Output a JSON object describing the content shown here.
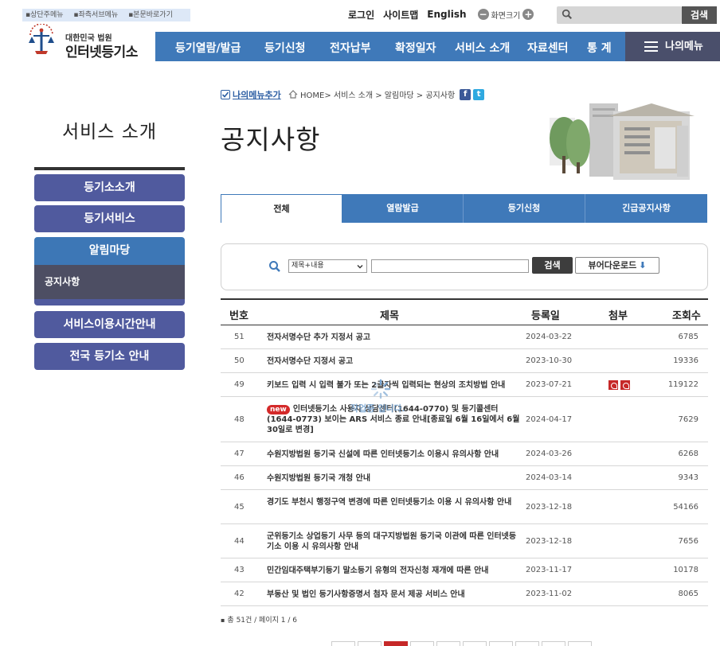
{
  "skip_links": [
    "상단주메뉴",
    "좌측서브메뉴",
    "본문바로가기"
  ],
  "util": {
    "login": "로그인",
    "sitemap": "사이트맵",
    "english": "English",
    "zoom_label": "화면크기",
    "search_button": "검색"
  },
  "logo": {
    "line1": "대한민국 법원",
    "line2": "인터넷등기소"
  },
  "gnb": {
    "items": [
      "등기열람/발급",
      "등기신청",
      "전자납부",
      "확정일자",
      "서비스 소개",
      "자료센터",
      "통 계"
    ],
    "mymenu": "나의메뉴"
  },
  "lnb": {
    "title": "서비스 소개",
    "items": [
      "등기소소개",
      "등기서비스",
      "알림마당",
      "서비스이용시간안내",
      "전국 등기소 안내"
    ],
    "active_sub": "공지사항"
  },
  "content": {
    "add_menu": "나의메뉴추가",
    "breadcrumb": "HOME> 서비스 소개 > 알림마당 > 공지사항",
    "title": "공지사항"
  },
  "tabs": [
    "전체",
    "열람발급",
    "등기신청",
    "긴급공지사항"
  ],
  "search": {
    "select_value": "제목+내용",
    "input_value": "",
    "search_button": "검색",
    "viewer_button": "뷰어다운로드"
  },
  "table": {
    "headers": [
      "번호",
      "제목",
      "등록일",
      "첨부",
      "조회수"
    ],
    "rows": [
      {
        "no": "51",
        "title": "전자서명수단 추가 지정서 공고",
        "date": "2024-03-22",
        "attach": 0,
        "views": "6785",
        "new": false
      },
      {
        "no": "50",
        "title": "전자서명수단 지정서 공고",
        "date": "2023-10-30",
        "attach": 0,
        "views": "19336",
        "new": false
      },
      {
        "no": "49",
        "title": "키보드 입력 시 입력 불가 또는 2글자씩 입력되는 현상의 조치방법 안내",
        "date": "2023-07-21",
        "attach": 2,
        "views": "119122",
        "new": false
      },
      {
        "no": "48",
        "title": "인터넷등기소 사용자 상담센터(1644-0770) 및 등기콜센터(1644-0773) 보이는 ARS 서비스 종료 안내[종료일 6월 16일에서 6월 30일로 변경]",
        "date": "2024-04-17",
        "attach": 0,
        "views": "7629",
        "new": true
      },
      {
        "no": "47",
        "title": "수원지방법원 등기국 신설에 따른 인터넷등기소 이용시 유의사항 안내",
        "date": "2024-03-26",
        "attach": 0,
        "views": "6268",
        "new": false
      },
      {
        "no": "46",
        "title": "수원지방법원 등기국 개청 안내",
        "date": "2024-03-14",
        "attach": 0,
        "views": "9343",
        "new": false
      },
      {
        "no": "45",
        "title": "경기도 부천시 행정구역 변경에 따른 인터넷등기소 이용 시 유의사항 안내",
        "date": "2023-12-18",
        "attach": 0,
        "views": "54166",
        "new": false
      },
      {
        "no": "44",
        "title": "군위등기소 상업등기 사무 등의 대구지방법원 등기국 이관에 따른 인터넷등기소 이용 시 유의사항 안내",
        "date": "2023-12-18",
        "attach": 0,
        "views": "7656",
        "new": false
      },
      {
        "no": "43",
        "title": "민간임대주택부기등기 말소등기 유형의 전자신청 재개에 따른 안내",
        "date": "2023-11-17",
        "attach": 0,
        "views": "10178",
        "new": false
      },
      {
        "no": "42",
        "title": "부동산 및 법인 등기사항증명서 첨자 문서 제공 서비스 안내",
        "date": "2023-11-02",
        "attach": 0,
        "views": "8065",
        "new": false
      }
    ]
  },
  "new_badge": "new",
  "loading_text": "작업중 입니다.",
  "total": "총 51건 / 페이지 1 / 6",
  "colors": {
    "nav_blue": "#3f79b9",
    "lnb_purple": "#505a9e",
    "mymenu_bg": "#4a4f6b",
    "new_badge": "#d42a2a"
  }
}
